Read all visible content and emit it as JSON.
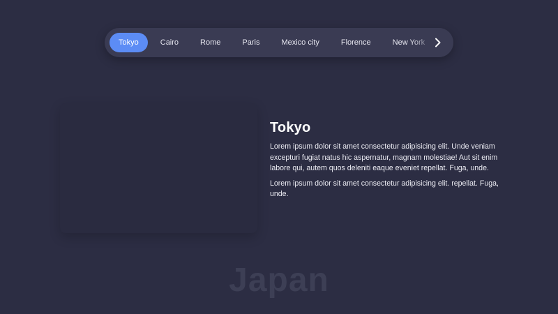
{
  "tabs": [
    {
      "label": "Tokyo",
      "active": true
    },
    {
      "label": "Cairo",
      "active": false
    },
    {
      "label": "Rome",
      "active": false
    },
    {
      "label": "Paris",
      "active": false
    },
    {
      "label": "Mexico city",
      "active": false
    },
    {
      "label": "Florence",
      "active": false
    },
    {
      "label": "New York",
      "active": false
    }
  ],
  "next_button": {
    "icon": "chevron-right-icon"
  },
  "content": {
    "title": "Tokyo",
    "paragraph1": "Lorem ipsum dolor sit amet consectetur adipisicing elit. Unde veniam excepturi fugiat natus hic aspernatur, magnam molestiae! Aut sit enim labore qui, autem quos deleniti eaque eveniet repellat. Fuga, unde.",
    "paragraph2": "Lorem ipsum dolor sit amet consectetur adipisicing elit. repellat. Fuga, unde."
  },
  "country": "Japan",
  "colors": {
    "background": "#2c2d43",
    "tabbar": "#3a3b53",
    "accent": "#5c8cf5",
    "watermark": "#3d3f55"
  }
}
